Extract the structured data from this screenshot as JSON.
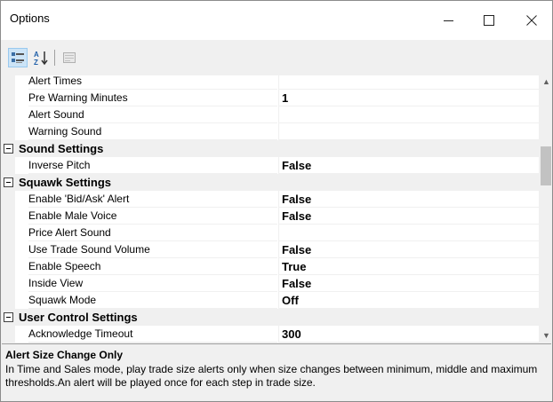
{
  "window": {
    "title": "Options"
  },
  "toolbar": {
    "categorized_icon": "categorized-icon",
    "alphabetical_icon": "alphabetical-icon",
    "property_pages_icon": "property-pages-icon"
  },
  "grid": {
    "rows": [
      {
        "kind": "prop",
        "name": "Alert Times",
        "value": ""
      },
      {
        "kind": "prop",
        "name": "Pre Warning Minutes",
        "value": "1"
      },
      {
        "kind": "prop",
        "name": "Alert Sound",
        "value": ""
      },
      {
        "kind": "prop",
        "name": "Warning Sound",
        "value": ""
      },
      {
        "kind": "cat",
        "name": "Sound Settings"
      },
      {
        "kind": "prop",
        "name": "Inverse Pitch",
        "value": "False"
      },
      {
        "kind": "cat",
        "name": "Squawk Settings"
      },
      {
        "kind": "prop",
        "name": "Enable 'Bid/Ask' Alert",
        "value": "False"
      },
      {
        "kind": "prop",
        "name": "Enable Male Voice",
        "value": "False"
      },
      {
        "kind": "prop",
        "name": "Price Alert Sound",
        "value": ""
      },
      {
        "kind": "prop",
        "name": "Use Trade Sound Volume",
        "value": "False"
      },
      {
        "kind": "prop",
        "name": "Enable Speech",
        "value": "True"
      },
      {
        "kind": "prop",
        "name": "Inside View",
        "value": "False"
      },
      {
        "kind": "prop",
        "name": "Squawk Mode",
        "value": "Off"
      },
      {
        "kind": "cat",
        "name": "User Control Settings"
      },
      {
        "kind": "prop",
        "name": "Acknowledge Timeout",
        "value": "300"
      }
    ]
  },
  "description": {
    "title": "Alert Size Change Only",
    "text": "In Time and Sales mode, play trade size alerts only when size changes between minimum, middle and maximum thresholds.An alert will be played once for each step in trade size."
  },
  "colors": {
    "selected_button": "#cce4f7",
    "category_bg": "#f0f0f0",
    "grid_line": "#f0f0f0"
  }
}
